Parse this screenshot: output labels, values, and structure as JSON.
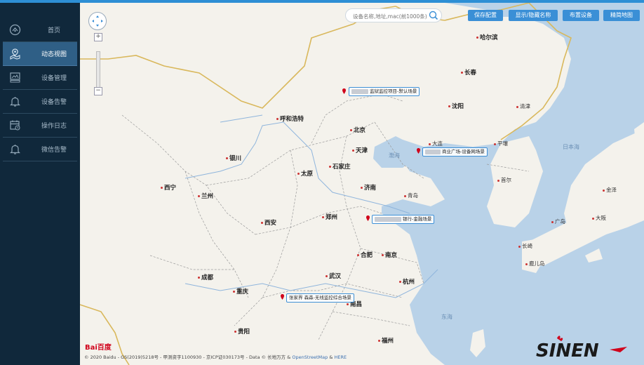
{
  "sidebar": {
    "items": [
      {
        "label": "首页",
        "icon": "dashboard-icon",
        "active": false
      },
      {
        "label": "动态视图",
        "icon": "map-pin-icon",
        "active": true
      },
      {
        "label": "设备管理",
        "icon": "device-icon",
        "active": false
      },
      {
        "label": "设备告警",
        "icon": "bell-icon",
        "active": false
      },
      {
        "label": "操作日志",
        "icon": "calendar-icon",
        "active": false
      },
      {
        "label": "微信告警",
        "icon": "bell-icon",
        "active": false
      }
    ]
  },
  "toolbar": {
    "search_placeholder": "设备名称,地址,mac(前1000条)",
    "save_label": "保存配置",
    "toggle_names_label": "显示/隐藏名称",
    "deploy_label": "布置设备",
    "simple_map_label": "精简地图"
  },
  "map": {
    "cities": [
      {
        "name": "北京",
        "big": true
      },
      {
        "name": "天津",
        "big": true
      },
      {
        "name": "石家庄",
        "big": true
      },
      {
        "name": "太原",
        "big": true
      },
      {
        "name": "呼和浩特",
        "big": true
      },
      {
        "name": "济南",
        "big": true
      },
      {
        "name": "郑州",
        "big": true
      },
      {
        "name": "西安",
        "big": true
      },
      {
        "name": "兰州",
        "big": true
      },
      {
        "name": "西宁",
        "big": true
      },
      {
        "name": "银川",
        "big": true
      },
      {
        "name": "成都",
        "big": true
      },
      {
        "name": "重庆",
        "big": true
      },
      {
        "name": "武汉",
        "big": true
      },
      {
        "name": "合肥",
        "big": true
      },
      {
        "name": "南京",
        "big": true
      },
      {
        "name": "杭州",
        "big": true
      },
      {
        "name": "南昌",
        "big": true
      },
      {
        "name": "贵阳",
        "big": true
      },
      {
        "name": "福州",
        "big": true
      },
      {
        "name": "沈阳",
        "big": true
      },
      {
        "name": "长春",
        "big": true
      },
      {
        "name": "哈尔滨",
        "big": true
      },
      {
        "name": "大连",
        "big": false
      },
      {
        "name": "青岛",
        "big": false
      },
      {
        "name": "首尔",
        "big": false
      },
      {
        "name": "平壤",
        "big": false
      },
      {
        "name": "清津",
        "big": false
      },
      {
        "name": "大阪",
        "big": false
      },
      {
        "name": "长崎",
        "big": false
      },
      {
        "name": "鹿儿岛",
        "big": false
      },
      {
        "name": "金泽",
        "big": false
      },
      {
        "name": "广岛",
        "big": false
      }
    ],
    "seas": [
      "渤海",
      "日本海",
      "东海"
    ],
    "markers": [
      {
        "label": "监狱监控项目-默认场景"
      },
      {
        "label": "商业广场-设备网场景"
      },
      {
        "label": "银行-金融场景"
      },
      {
        "label": "张家界 森森-无线监控综合场景"
      }
    ],
    "copyright_text": "© 2020 Baidu - GS(2019)5218号 - 甲测资字1100930 - 京ICP证030173号 - Data © 长地万方 &",
    "osm_link": "OpenStreetMap",
    "here_link": "HERE",
    "baidu_logo": "Bai百度",
    "brand_logo": "SINEN"
  }
}
